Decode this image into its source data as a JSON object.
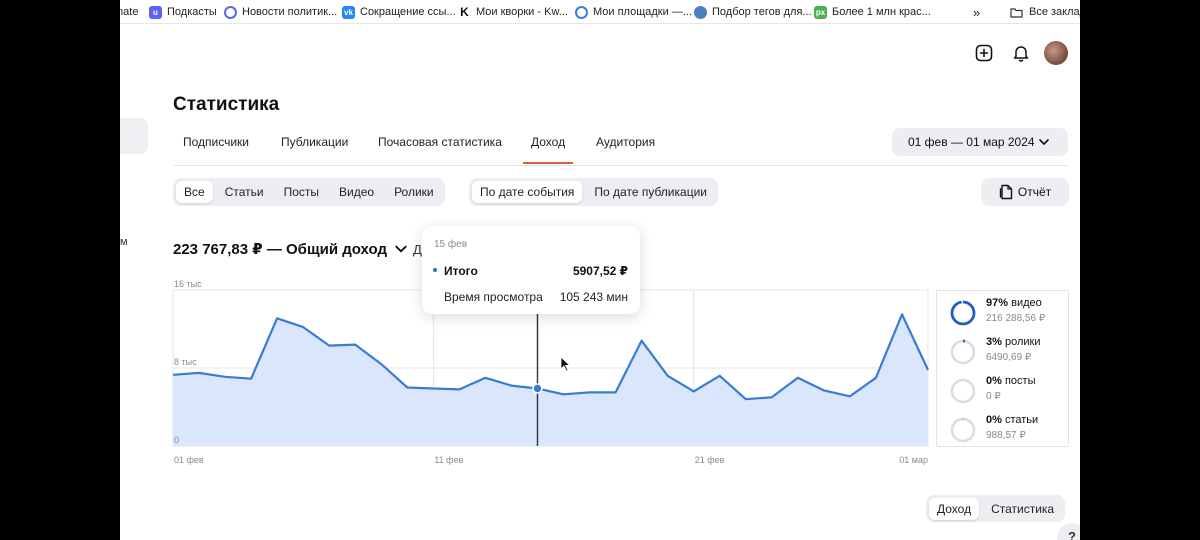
{
  "bookmarks": [
    {
      "label": "mate",
      "icon": "bookmark-icon",
      "color": "#ffffff"
    },
    {
      "label": "Подкасты",
      "icon": "podcast-icon",
      "color": "#5a63f5"
    },
    {
      "label": "Новости политик...",
      "icon": "news-icon",
      "color": "#5b6cd8"
    },
    {
      "label": "Сокращение ссы...",
      "icon": "vk-icon",
      "color": "#2787f5"
    },
    {
      "label": "Мои кворки - Kw...",
      "icon": "kwork-icon",
      "color": "#111111"
    },
    {
      "label": "Мои площадки —...",
      "icon": "site-icon",
      "color": "#3d7bdc"
    },
    {
      "label": "Подбор тегов для...",
      "icon": "tags-icon",
      "color": "#4a7fc1"
    },
    {
      "label": "Более 1 млн крас...",
      "icon": "px-icon",
      "color": "#4caf50"
    }
  ],
  "bookmarks_more": "»",
  "bookmarks_folder": "Все заклад",
  "left_fragment": "м",
  "page_title": "Статистика",
  "tabs": [
    {
      "label": "Подписчики",
      "active": false
    },
    {
      "label": "Публикации",
      "active": false
    },
    {
      "label": "Почасовая статистика",
      "active": false
    },
    {
      "label": "Доход",
      "active": true
    },
    {
      "label": "Аудитория",
      "active": false
    }
  ],
  "date_range": "01 фев — 01 мар 2024",
  "content_filter": [
    {
      "label": "Все",
      "active": true
    },
    {
      "label": "Статьи",
      "active": false
    },
    {
      "label": "Посты",
      "active": false
    },
    {
      "label": "Видео",
      "active": false
    },
    {
      "label": "Ролики",
      "active": false
    }
  ],
  "date_filter": [
    {
      "label": "По дате события",
      "active": true
    },
    {
      "label": "По дате публикации",
      "active": false
    }
  ],
  "report_label": "Отчёт",
  "total_income": "223 767,83 ₽ — Общий доход",
  "total_fragment": "Д",
  "tooltip": {
    "date": "15 фев",
    "total_label": "Итого",
    "total_value": "5907,52 ₽",
    "watch_label": "Время просмотра",
    "watch_value": "105 243 мин"
  },
  "chart_data": {
    "type": "area",
    "x": [
      "01 фев",
      "02 фев",
      "03 фев",
      "04 фев",
      "05 фев",
      "06 фев",
      "07 фев",
      "08 фев",
      "09 фев",
      "10 фев",
      "11 фев",
      "12 фев",
      "13 фев",
      "14 фев",
      "15 фев",
      "16 фев",
      "17 фев",
      "18 фев",
      "19 фев",
      "20 фев",
      "21 фев",
      "22 фев",
      "23 фев",
      "24 фев",
      "25 фев",
      "26 фев",
      "27 фев",
      "28 фев",
      "29 фев",
      "01 мар"
    ],
    "x_tick_labels": [
      "01 фев",
      "11 фев",
      "21 фев",
      "01 мар"
    ],
    "y_tick_labels": [
      "0",
      "8 тыс",
      "16 тыс"
    ],
    "ylim": [
      0,
      16000
    ],
    "series": [
      {
        "values": [
          7300,
          7500,
          7100,
          6900,
          13100,
          12200,
          10300,
          10400,
          8400,
          6000,
          5900,
          5800,
          7000,
          6200,
          5900,
          5300,
          5500,
          5500,
          10800,
          7200,
          5600,
          7200,
          4800,
          5000,
          7000,
          5700,
          5100,
          7000,
          13500,
          7800
        ],
        "color": "#3a7bd5",
        "fill": "#d9e6fb"
      }
    ],
    "highlight_index": 14,
    "grid": true
  },
  "legend": [
    {
      "pct": "97%",
      "label": "видео",
      "amount": "216 288,56 ₽",
      "fraction": 0.97
    },
    {
      "pct": "3%",
      "label": "ролики",
      "amount": "6490,69 ₽",
      "fraction": 0.03
    },
    {
      "pct": "0%",
      "label": "посты",
      "amount": "0 ₽",
      "fraction": 0.0
    },
    {
      "pct": "0%",
      "label": "статьи",
      "amount": "988,57 ₽",
      "fraction": 0.004
    }
  ],
  "bottom_toggle": [
    {
      "label": "Доход",
      "active": true
    },
    {
      "label": "Статистика",
      "active": false
    }
  ],
  "help_label": "?"
}
